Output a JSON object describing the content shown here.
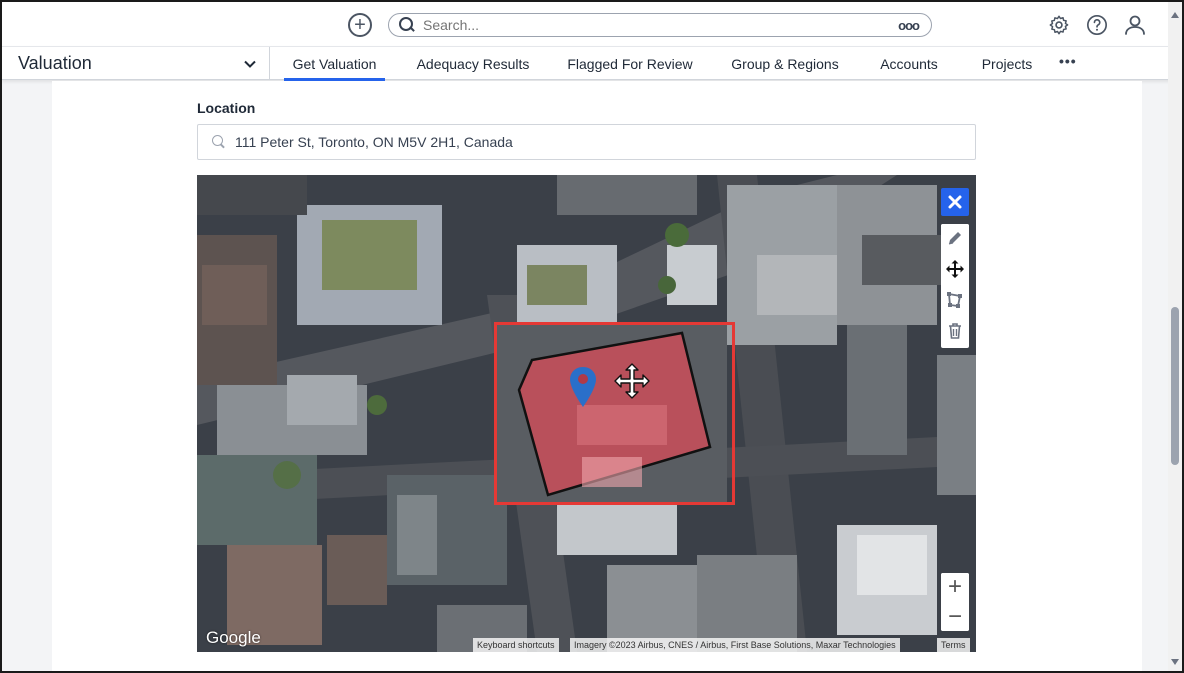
{
  "header": {
    "search_placeholder": "Search...",
    "search_options": "ooo",
    "icons": [
      "add-circle-icon",
      "search-icon",
      "more-options-icon",
      "settings-gear-icon",
      "help-icon",
      "user-icon"
    ]
  },
  "nav": {
    "app_name": "Valuation",
    "tabs": [
      {
        "label": "Get Valuation",
        "active": true
      },
      {
        "label": "Adequacy Results",
        "active": false
      },
      {
        "label": "Flagged For Review",
        "active": false
      },
      {
        "label": "Group & Regions",
        "active": false
      },
      {
        "label": "Accounts",
        "active": false
      },
      {
        "label": "Projects",
        "active": false
      }
    ],
    "more": "•••"
  },
  "location": {
    "label": "Location",
    "value": "111 Peter St, Toronto, ON M5V 2H1, Canada"
  },
  "map": {
    "google_logo": "Google",
    "attribution": {
      "keyboard": "Keyboard shortcuts",
      "imagery": "Imagery ©2023 Airbus, CNES / Airbus, First Base Solutions, Maxar Technologies",
      "terms": "Terms"
    },
    "zoom_in": "+",
    "zoom_out": "−",
    "colors": {
      "polygon_fill": "#d94c5a",
      "polygon_stroke": "#111111",
      "highlight": "#e53935",
      "pin": "#2a6fc9",
      "accent": "#2563eb"
    }
  }
}
